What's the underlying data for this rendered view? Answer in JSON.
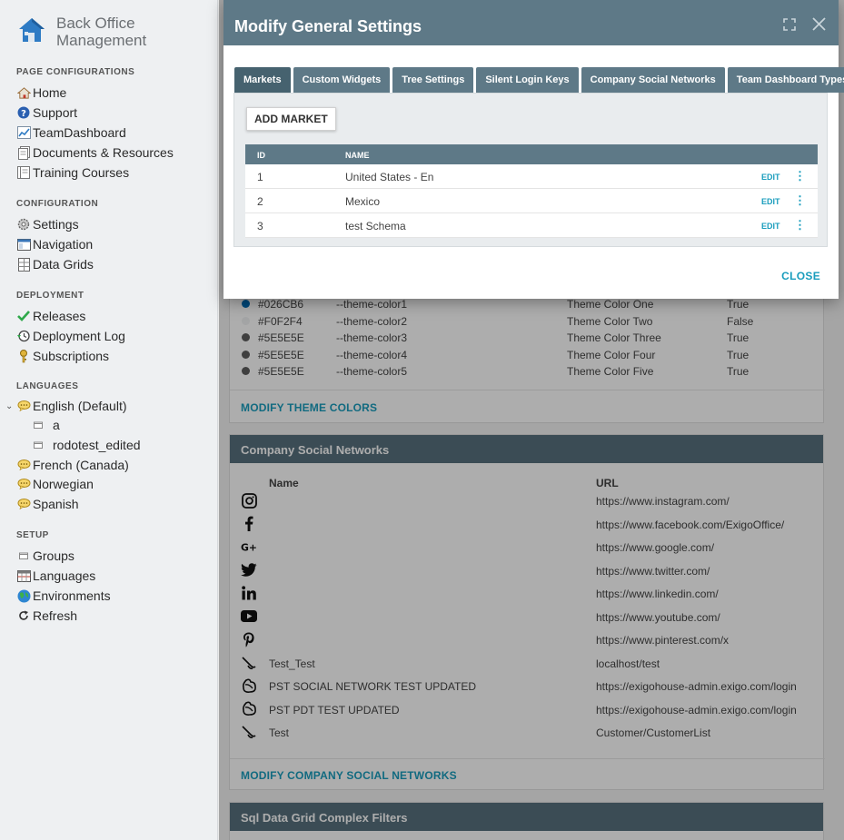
{
  "sidebar": {
    "brand": {
      "line1": "Back Office",
      "line2": "Management"
    },
    "sections": {
      "page_config": "PAGE CONFIGURATIONS",
      "configuration": "CONFIGURATION",
      "deployment": "DEPLOYMENT",
      "languages": "LANGUAGES",
      "setup": "SETUP"
    },
    "items": {
      "home": "Home",
      "support": "Support",
      "team_dashboard": "TeamDashboard",
      "documents": "Documents & Resources",
      "training": "Training Courses",
      "settings": "Settings",
      "navigation": "Navigation",
      "data_grids": "Data Grids",
      "releases": "Releases",
      "deployment_log": "Deployment Log",
      "subscriptions": "Subscriptions",
      "english": "English (Default)",
      "sub_a": "a",
      "sub_rodotest": "rodotest_edited",
      "french": "French (Canada)",
      "norwegian": "Norwegian",
      "spanish": "Spanish",
      "groups": "Groups",
      "languages_item": "Languages",
      "environments": "Environments",
      "refresh": "Refresh"
    }
  },
  "theme_colors": {
    "rows": [
      {
        "hex": "#026CB6",
        "var": "--theme-color1",
        "name": "Theme Color One",
        "flag": "True",
        "dot": "#026CB6"
      },
      {
        "hex": "#F0F2F4",
        "var": "--theme-color2",
        "name": "Theme Color Two",
        "flag": "False",
        "dot": "#F0F2F4"
      },
      {
        "hex": "#5E5E5E",
        "var": "--theme-color3",
        "name": "Theme Color Three",
        "flag": "True",
        "dot": "#5E5E5E"
      },
      {
        "hex": "#5E5E5E",
        "var": "--theme-color4",
        "name": "Theme Color Four",
        "flag": "True",
        "dot": "#5E5E5E"
      },
      {
        "hex": "#5E5E5E",
        "var": "--theme-color5",
        "name": "Theme Color Five",
        "flag": "True",
        "dot": "#5E5E5E"
      }
    ],
    "modify_label": "MODIFY THEME COLORS"
  },
  "social": {
    "title": "Company Social Networks",
    "col_name": "Name",
    "col_url": "URL",
    "rows": [
      {
        "icon": "instagram-icon",
        "name": "",
        "url": "https://www.instagram.com/"
      },
      {
        "icon": "facebook-icon",
        "name": "",
        "url": "https://www.facebook.com/ExigoOffice/"
      },
      {
        "icon": "google-plus-icon",
        "name": "",
        "url": "https://www.google.com/"
      },
      {
        "icon": "twitter-icon",
        "name": "",
        "url": "https://www.twitter.com/"
      },
      {
        "icon": "linkedin-icon",
        "name": "",
        "url": "https://www.linkedin.com/"
      },
      {
        "icon": "youtube-icon",
        "name": "",
        "url": "https://www.youtube.com/"
      },
      {
        "icon": "pinterest-icon",
        "name": "",
        "url": "https://www.pinterest.com/x"
      },
      {
        "icon": "custom-link-icon",
        "name": "Test_Test",
        "url": "localhost/test"
      },
      {
        "icon": "custom-blob-icon",
        "name": "PST SOCIAL NETWORK TEST UPDATED",
        "url": "https://exigohouse-admin.exigo.com/login"
      },
      {
        "icon": "custom-blob-icon",
        "name": "PST PDT TEST UPDATED",
        "url": "https://exigohouse-admin.exigo.com/login"
      },
      {
        "icon": "custom-link-icon",
        "name": "Test",
        "url": "Customer/CustomerList"
      }
    ],
    "modify_label": "MODIFY COMPANY SOCIAL NETWORKS"
  },
  "sql_grid": {
    "title": "Sql Data Grid Complex Filters"
  },
  "modal": {
    "title": "Modify General Settings",
    "tabs": [
      "Markets",
      "Custom Widgets",
      "Tree Settings",
      "Silent Login Keys",
      "Company Social Networks",
      "Team Dashboard Types"
    ],
    "add_label": "ADD MARKET",
    "table": {
      "col_id": "ID",
      "col_name": "NAME",
      "rows": [
        {
          "id": "1",
          "name": "United States - En"
        },
        {
          "id": "2",
          "name": "Mexico"
        },
        {
          "id": "3",
          "name": "test Schema"
        }
      ],
      "edit_label": "EDIT"
    },
    "close_label": "CLOSE"
  }
}
